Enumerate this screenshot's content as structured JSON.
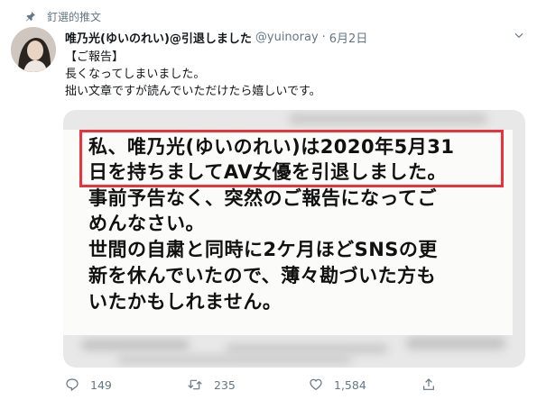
{
  "pinned": {
    "label": "釘選的推文",
    "icon": "pin-icon"
  },
  "tweet": {
    "author": {
      "display_name": "唯乃光(ゆいのれい)@引退しました",
      "handle": "@yuinoray",
      "separator": "·",
      "date": "6月2日"
    },
    "text_lines": [
      "【ご報告】",
      "長くなってしまいました。",
      "拙い文章ですが読んでいただけたら嬉しいです。"
    ],
    "media": {
      "highlight_color": "#e8333a",
      "lines": [
        "私、唯乃光(ゆいのれい)は2020年5月31",
        "日を持ちましてAV女優を引退しました。",
        "事前予告なく、突然のご報告になってご",
        "めんなさい。",
        "世間の自粛と同時に2ケ月ほどSNSの更",
        "新を休んでいたので、薄々勘づいた方も",
        "いたかもしれません。"
      ]
    },
    "actions": {
      "reply_count": "149",
      "retweet_count": "235",
      "like_count": "1,584"
    }
  }
}
